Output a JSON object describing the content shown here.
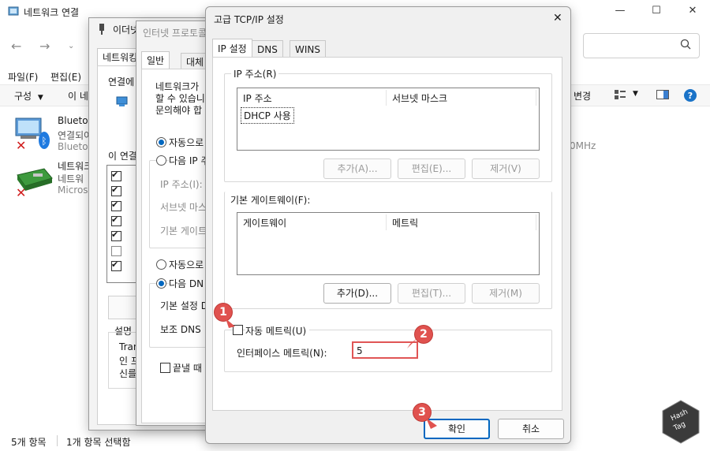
{
  "explorer": {
    "title": "네트워크 연결",
    "menu": [
      "파일(F)",
      "편집(E)"
    ],
    "cmd": {
      "organize": "구성",
      "label2": "이 네",
      "change": "변경"
    },
    "items": [
      {
        "line1": "Bluetoo",
        "line2": "연결되어",
        "line3": "Blueto"
      },
      {
        "line1": "네트워크",
        "line2": "네트워",
        "line3": "Microso"
      }
    ],
    "extra_text": "0MHz",
    "status_left": "5개 항목",
    "status_right": "1개 항목 선택함"
  },
  "dialog1": {
    "title": "이더넷",
    "tab": "네트워킹",
    "connect_label": "연결에",
    "this_conn": "이 연결",
    "desc_label": "설명",
    "desc_lines": [
      "Tran",
      "인 프",
      "신를"
    ]
  },
  "dialog2": {
    "title": "인터넷 프로토콜",
    "tab1": "일반",
    "tab2": "대체",
    "intro": [
      "네트워크가",
      "할 수 있습니",
      "문의해야 합"
    ],
    "auto_ip": "자동으로",
    "manual_ip": "다음 IP 주",
    "ip_addr": "IP 주소(I):",
    "subnet": "서브넷 마스",
    "gateway": "기본 게이트",
    "auto_dns": "자동으로",
    "manual_dns": "다음 DN",
    "pref_dns": "기본 설정 D",
    "alt_dns": "보조 DNS",
    "exit_validate": "끝낼 때"
  },
  "dialog3": {
    "title": "고급 TCP/IP 설정",
    "tabs": [
      "IP 설정",
      "DNS",
      "WINS"
    ],
    "ip_group": "IP 주소(R)",
    "ip_col1": "IP 주소",
    "ip_col2": "서브넷 마스크",
    "ip_row": "DHCP 사용",
    "btn_add_a": "추가(A)...",
    "btn_edit_e": "편집(E)...",
    "btn_remove_v": "제거(V)",
    "gw_group": "기본 게이트웨이(F):",
    "gw_col1": "게이트웨이",
    "gw_col2": "메트릭",
    "btn_add_d": "추가(D)...",
    "btn_edit_t": "편집(T)...",
    "btn_remove_m": "제거(M)",
    "auto_metric": "자동 메트릭(U)",
    "iface_metric_label": "인터페이스 메트릭(N):",
    "iface_metric_value": "5",
    "ok": "확인",
    "cancel": "취소"
  },
  "markers": [
    "1",
    "2",
    "3"
  ],
  "watermark": {
    "line1": "Hash",
    "line2": "Tag"
  },
  "colors": {
    "accent": "#0067c0",
    "marker": "#e0524f"
  }
}
